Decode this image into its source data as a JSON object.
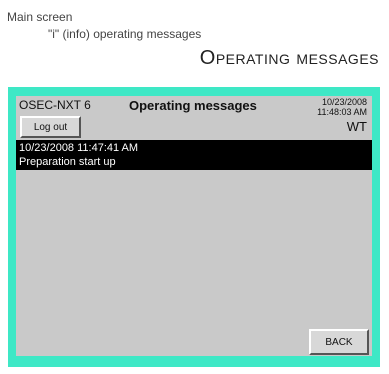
{
  "breadcrumb": {
    "level1": "Main screen",
    "level2": "\"i\" (info) operating messages"
  },
  "section_title": "Operating messages",
  "screen": {
    "app_name": "OSEC-NXT 6",
    "title": "Operating messages",
    "date": "10/23/2008",
    "time": "11:48:03 AM",
    "user": "WT",
    "logout_label": "Log out",
    "back_label": "BACK",
    "messages": [
      {
        "timestamp": "10/23/2008 11:47:41 AM",
        "text": "Preparation start up"
      }
    ]
  },
  "colors": {
    "screen_border": "#3ee8c6",
    "panel_bg": "#c9c9c9",
    "selected_row_bg": "#000000",
    "selected_row_text": "#ffffff"
  }
}
